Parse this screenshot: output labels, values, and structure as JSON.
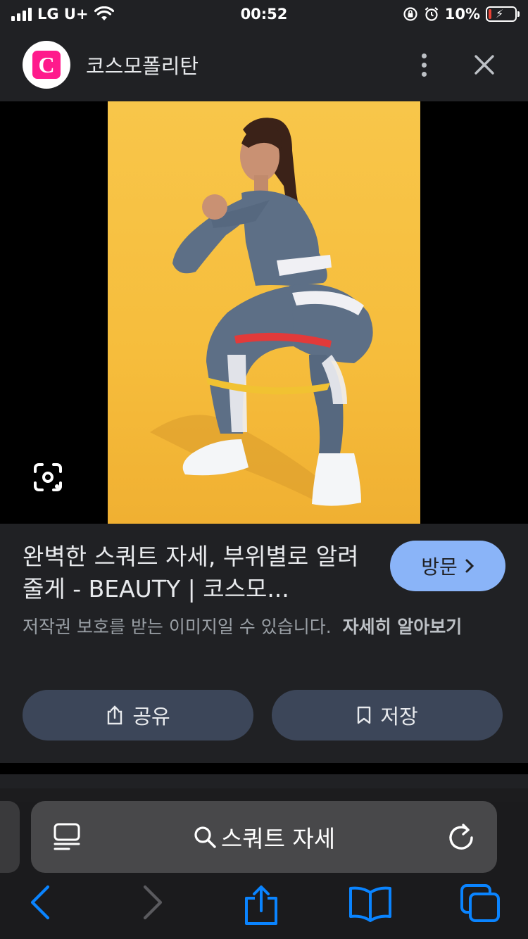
{
  "status_bar": {
    "carrier": "LG U+",
    "time": "00:52",
    "battery_percent": "10%",
    "battery_level": 0.1
  },
  "header": {
    "logo_letter": "C",
    "site_name": "코스모폴리탄"
  },
  "result": {
    "title": "완벽한 스쿼트 자세, 부위별로 알려줄게 - BEAUTY | 코스모...",
    "visit_label": "방문",
    "copyright_text": "저작권 보호를 받는 이미지일 수 있습니다.",
    "learn_more": "자세히 알아보기",
    "share_label": "공유",
    "save_label": "저장"
  },
  "browser": {
    "search_query": "스쿼트 자세"
  },
  "colors": {
    "accent": "#8ab4f8",
    "brand": "#ff1a8c",
    "panel": "#202124",
    "photo_bg": "#f8c64a",
    "ios_blue": "#0a84ff"
  }
}
